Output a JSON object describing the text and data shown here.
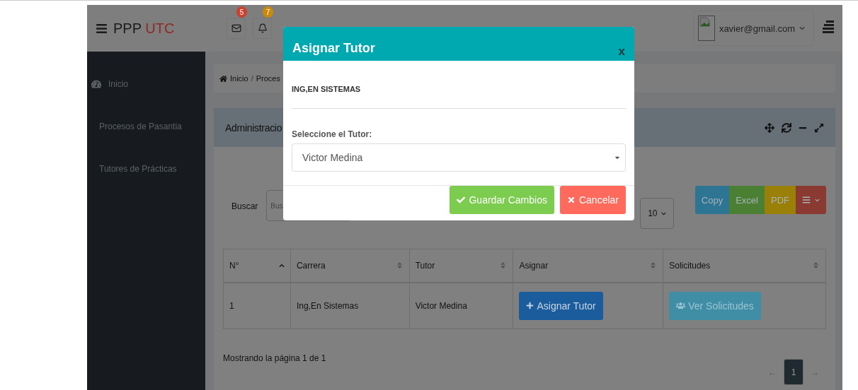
{
  "topbar": {
    "brand": "PPP",
    "brand_accent": "UTC",
    "notifications": [
      {
        "kind": "mail",
        "count": "5",
        "color": "#c9412f"
      },
      {
        "kind": "bell",
        "count": "7",
        "color": "#c98a0c"
      }
    ],
    "user": {
      "email": "xavier@gmail.com"
    }
  },
  "sidebar": {
    "items": [
      {
        "label": "Inicio",
        "kind": "icon"
      },
      {
        "label": "Procesos de Pasantia",
        "kind": "plain"
      },
      {
        "label": "Tutores de Prácticas",
        "kind": "plain"
      }
    ]
  },
  "breadcrumb": {
    "items": [
      "Inicio",
      "Proces"
    ],
    "separator": "/"
  },
  "panel": {
    "title": "Administracio",
    "search": {
      "label": "Buscar",
      "placeholder": "Bus"
    },
    "page_size": "10",
    "export_buttons": [
      {
        "kind": "text",
        "label": "Copy",
        "color": "#2d7592"
      },
      {
        "kind": "text",
        "label": "Excel",
        "color": "#4a7f34"
      },
      {
        "kind": "text",
        "label": "PDF",
        "color": "#9a8008"
      },
      {
        "kind": "menu",
        "color": "#8a3a30"
      }
    ],
    "table": {
      "columns": [
        {
          "label": "N°",
          "sorted": true
        },
        {
          "label": "Carrera",
          "sorted": false
        },
        {
          "label": "Tutor",
          "sorted": false
        },
        {
          "label": "Asignar",
          "sorted": false
        },
        {
          "label": "Solicitudes",
          "sorted": false
        }
      ],
      "rows": [
        {
          "number": "1",
          "career": "Ing,En Sistemas",
          "tutor": "Victor Medina",
          "assign": "Asignar Tutor",
          "requests": "Ver Solicitudes"
        }
      ]
    },
    "footer": "Mostrando la página 1 de 1",
    "pagination": {
      "prev": "←",
      "next": "→",
      "pages": [
        {
          "label": "1",
          "selected": true
        }
      ]
    }
  },
  "modal": {
    "title": "Asignar Tutor",
    "close": "x",
    "career": "ING,EN SISTEMAS",
    "label": "Seleccione el Tutor:",
    "value": "Victor Medina",
    "save": "Guardar Cambios",
    "cancel": "Cancelar"
  }
}
